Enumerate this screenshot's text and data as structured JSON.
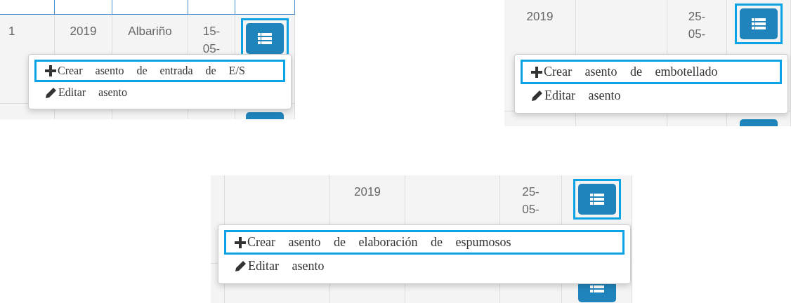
{
  "snippets": [
    {
      "cells": [
        "1",
        "2019",
        "Albariño",
        "15-05-"
      ],
      "action_button": {
        "highlighted": true
      },
      "menu": [
        {
          "kind": "create",
          "label": "Crear asento de entrada de E/S",
          "highlighted": true
        },
        {
          "kind": "edit",
          "label": "Editar asento",
          "highlighted": false
        }
      ]
    },
    {
      "cells": [
        "2019",
        "25-05-"
      ],
      "action_button": {
        "highlighted": true
      },
      "menu": [
        {
          "kind": "create",
          "label": "Crear asento de embotellado",
          "highlighted": true
        },
        {
          "kind": "edit",
          "label": "Editar asento",
          "highlighted": false
        }
      ]
    },
    {
      "cells": [
        "2019",
        "25-05-"
      ],
      "action_button": {
        "highlighted": true
      },
      "menu": [
        {
          "kind": "create",
          "label": "Crear asento de elaboración de espumosos",
          "highlighted": true
        },
        {
          "kind": "edit",
          "label": "Editar asento",
          "highlighted": false
        }
      ]
    }
  ]
}
